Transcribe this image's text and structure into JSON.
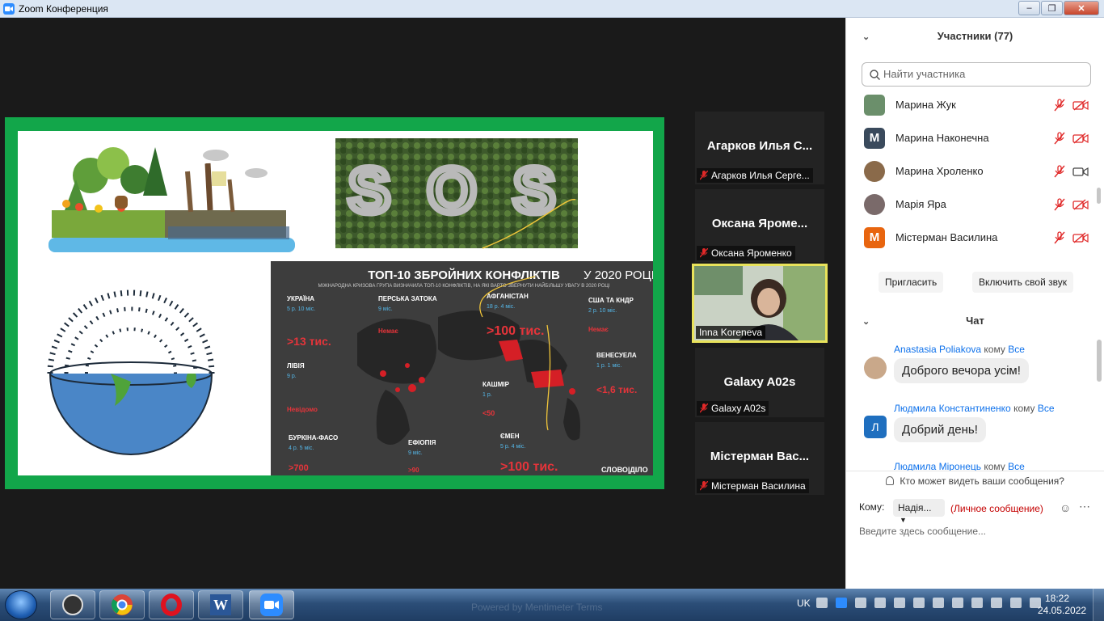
{
  "window": {
    "title": "Zoom Конференция",
    "controls": [
      "–",
      "❐",
      "✕"
    ]
  },
  "slide": {
    "infographic_title": "ТОП-10 ЗБРОЙНИХ КОНФЛІКТІВ",
    "infographic_year": "У 2020 РОЦІ",
    "infographic_subtitle": "МІЖНАРОДНА КРИЗОВА ГРУПА ВИЗНАЧИЛА ТОП-10 КОНФЛІКТІВ, НА ЯКІ ВАРТО ЗВЕРНУТИ НАЙБІЛЬШУ УВАГУ В 2020 РОЦІ",
    "sos_letters": "S O S",
    "brand": "СЛОВО|ДІЛО",
    "conflicts": [
      {
        "name": "УКРАЇНА",
        "duration": "5 р. 10 міс.",
        "toll": ">13 тис."
      },
      {
        "name": "ПЕРСЬКА ЗАТОКА",
        "duration": "9 міс.",
        "toll": "Немає"
      },
      {
        "name": "АФГАНІСТАН",
        "duration": "18 р. 4 міс.",
        "toll": ">100 тис."
      },
      {
        "name": "США ТА КНДР",
        "duration": "2 р. 10 міс.",
        "toll": "Немає"
      },
      {
        "name": "ЛІВІЯ",
        "duration": "9 р.",
        "toll": "Невідомо"
      },
      {
        "name": "ВЕНЕСУЕЛА",
        "duration": "1 р. 1 міс.",
        "toll": "<1,6 тис."
      },
      {
        "name": "КАШМІР",
        "duration": "1 р.",
        "toll": "<50"
      },
      {
        "name": "БУРКІНА-ФАСО",
        "duration": "4 р. 5 міс.",
        "toll": ">700"
      },
      {
        "name": "ЕФІОПІЯ",
        "duration": "9 міс.",
        "toll": ">90"
      },
      {
        "name": "ЄМЕН",
        "duration": "5 р. 4 міс.",
        "toll": ">100 тис."
      }
    ]
  },
  "thumbnails": [
    {
      "big": "Агарков Илья С...",
      "caption": "Агарков Илья Серге..."
    },
    {
      "big": "Оксана  Яроме...",
      "caption": "Оксана  Яроменко"
    },
    {
      "big": "Galaxy A02s",
      "caption": "Galaxy A02s"
    },
    {
      "big": "Містерман Вас...",
      "caption": "Містерман Василина"
    }
  ],
  "active_video": {
    "caption": "Inna Koreneva"
  },
  "participants": {
    "title": "Участники (77)",
    "search_placeholder": "Найти участника",
    "list": [
      {
        "name": "Марина Жук",
        "initial": "",
        "color": "#6b8f6b"
      },
      {
        "name": "Марина Наконечна",
        "initial": "M",
        "color": "#3a4a5c"
      },
      {
        "name": "Марина Хроленко",
        "initial": "",
        "color": "#8a6a4a"
      },
      {
        "name": "Марія Яра",
        "initial": "",
        "color": "#7a6a6a"
      },
      {
        "name": "Містерман Василина",
        "initial": "M",
        "color": "#e8650f"
      }
    ],
    "invite_label": "Пригласить",
    "unmute_label": "Включить свой звук"
  },
  "chat": {
    "title": "Чат",
    "messages": [
      {
        "from": "Anastasia Poliakova",
        "to_word": "кому",
        "to": "Все",
        "text": "Доброго вечора усім!",
        "initial": "",
        "color": "#c9a88a"
      },
      {
        "from": "Людмила Константиненко",
        "to_word": "кому",
        "to": "Все",
        "text": "Добрий день!",
        "initial": "Л",
        "color": "#1f6fbf"
      },
      {
        "from": "Людмила Міронець",
        "to_word": "кому",
        "to": "Все",
        "text": "",
        "initial": "",
        "color": ""
      }
    ],
    "privacy_text": "Кто может видеть ваши сообщения?",
    "to_label": "Кому:",
    "to_value": "Надія...",
    "private_label": "(Личное сообщение)",
    "input_placeholder": "Введите здесь сообщение..."
  },
  "taskbar": {
    "lang": "UK",
    "time": "18:22",
    "date": "24.05.2022",
    "ghost_text": "Powered by Mentimeter      Terms"
  }
}
